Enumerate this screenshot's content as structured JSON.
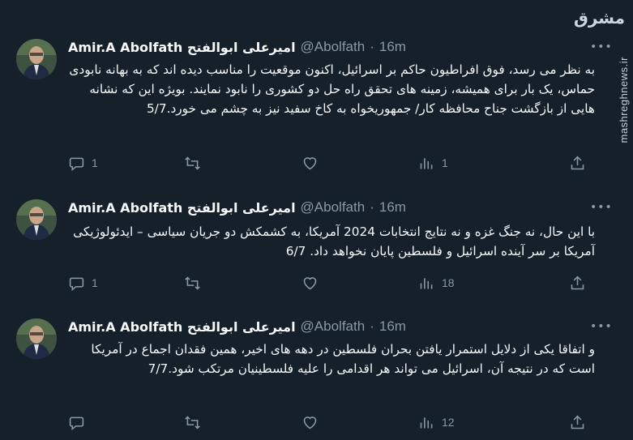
{
  "watermark": {
    "logo": "مشرق",
    "site": "mashreghnews.ir"
  },
  "tweets": [
    {
      "name": "Amir.A Abolfath امیرعلی ابوالفتح",
      "handle": "@Abolfath",
      "sep": "·",
      "time": "16m",
      "text": "به نظر می رسد، فوق افراطیون حاکم بر اسرائیل، اکنون موقعیت را مناسب دیده اند که به بهانه نابودی حماس، یک بار برای همیشه، زمینه های تحقق راه حل دو کشوری را نابود نمایند. بویژه این که نشانه هایی از بازگشت جناح محافظه کار/ جمهوریخواه به کاخ سفید نیز به چشم می خورد.5/7",
      "replies": "1",
      "retweets": "",
      "likes": "",
      "views": "1"
    },
    {
      "name": "Amir.A Abolfath امیرعلی ابوالفتح",
      "handle": "@Abolfath",
      "sep": "·",
      "time": "16m",
      "text": "با این حال، نه جنگ غزه و نه نتایج انتخابات 2024 آمریکا، به کشمکش دو جریان سیاسی – ایدئولوژیکی آمریکا بر سر آینده اسرائیل و فلسطین پایان نخواهد داد. 6/7",
      "replies": "1",
      "retweets": "",
      "likes": "",
      "views": "18"
    },
    {
      "name": "Amir.A Abolfath امیرعلی ابوالفتح",
      "handle": "@Abolfath",
      "sep": "·",
      "time": "16m",
      "text": "و اتفاقا یکی از دلایل استمرار یافتن بحران فلسطین در دهه های اخیر، همین فقدان اجماع در آمریکا است که در نتیجه آن، اسرائیل می تواند هر اقدامی را علیه فلسطینیان مرتکب شود.7/7",
      "replies": "",
      "retweets": "",
      "likes": "",
      "views": "12"
    }
  ]
}
